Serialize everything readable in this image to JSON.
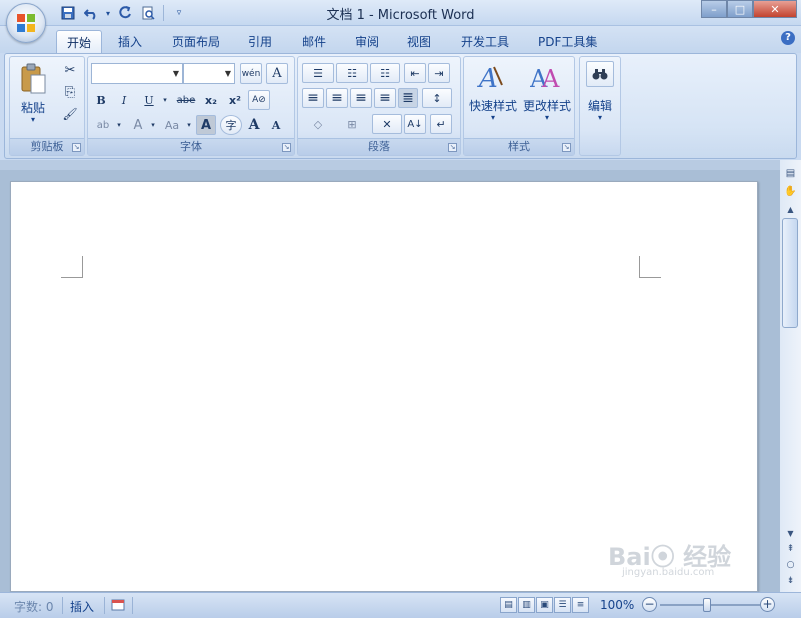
{
  "window": {
    "title": "文档 1 - Microsoft Word",
    "minimize": "–",
    "maximize": "□",
    "close": "✕"
  },
  "qat": {
    "save_icon": "save-icon",
    "undo_icon": "undo-icon",
    "redo_icon": "redo-icon",
    "print_preview_icon": "print-preview-icon",
    "customize_icon": "customize-arrow-icon"
  },
  "tabs": [
    {
      "label": "开始",
      "active": true
    },
    {
      "label": "插入"
    },
    {
      "label": "页面布局"
    },
    {
      "label": "引用"
    },
    {
      "label": "邮件"
    },
    {
      "label": "审阅"
    },
    {
      "label": "视图"
    },
    {
      "label": "开发工具"
    },
    {
      "label": "PDF工具集"
    }
  ],
  "help": "?",
  "ribbon": {
    "clipboard": {
      "label": "剪贴板",
      "paste_label": "粘贴",
      "cut_glyph": "✂",
      "copy_glyph": "⎘",
      "painter_glyph": "🖌"
    },
    "font": {
      "label": "字体",
      "font_name": "",
      "font_size": "",
      "phonetic_glyph": "wén",
      "border_char_glyph": "A",
      "bold": "B",
      "italic": "I",
      "underline": "U",
      "strike": "abe",
      "subscript": "x₂",
      "superscript": "x²",
      "clear_glyph": "A⊘",
      "highlight_glyph": "ab",
      "font_color_glyph": "A",
      "change_case_glyph": "Aa",
      "shading_glyph": "A",
      "enclose_glyph": "字",
      "grow_glyph": "A",
      "shrink_glyph": "A"
    },
    "paragraph": {
      "label": "段落",
      "bullets_glyph": "☰",
      "numbering_glyph": "☷",
      "multilevel_glyph": "☷",
      "decrease_indent_glyph": "⇤",
      "increase_indent_glyph": "⇥",
      "align_left_glyph": "≡",
      "center_glyph": "≡",
      "align_right_glyph": "≡",
      "justify_glyph": "≡",
      "distributed_glyph": "≣",
      "line_spacing_glyph": "↕",
      "shading_glyph": "◇",
      "borders_glyph": "⊞",
      "chinese_layout_glyph": "✕",
      "sort_glyph": "A↓",
      "show_marks_glyph": "↵"
    },
    "styles": {
      "label": "样式",
      "quick_styles": "快速样式",
      "change_styles": "更改样式"
    },
    "editing": {
      "label": "编辑",
      "find_glyph": "🔭"
    }
  },
  "statusbar": {
    "word_count": "字数: 0",
    "insert_mode": "插入",
    "zoom": "100%",
    "zoom_out": "−",
    "zoom_in": "+",
    "zoom_level": 1.0
  },
  "scrollbar": {
    "up": "▲",
    "down": "▼",
    "prev_page": "⇞",
    "select_browse": "○",
    "next_page": "⇟"
  },
  "watermark": {
    "brand": "Bai⦿ 经验",
    "url": "jingyan.baidu.com"
  },
  "colors": {
    "ribbon_bg": "#dae6f6",
    "accent_blue": "#15428b",
    "page_bg": "#ffffff",
    "workspace": "#a9bed6"
  }
}
